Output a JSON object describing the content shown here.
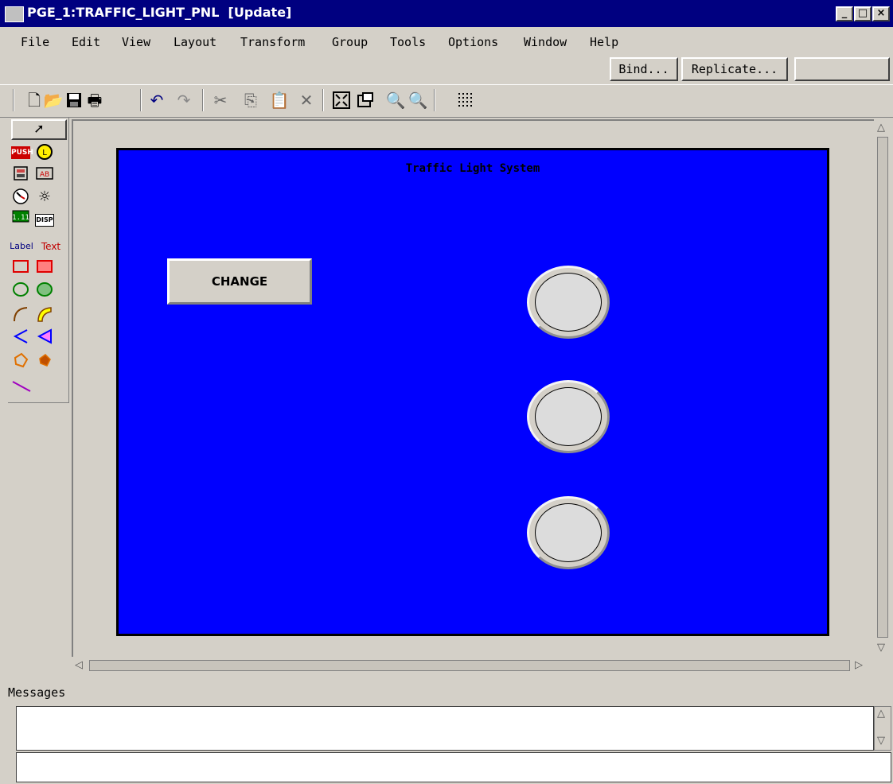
{
  "window": {
    "title": "PGE_1:TRAFFIC_LIGHT_PNL  [Update]",
    "controls": {
      "minimize": "_",
      "maximize": "□",
      "close": "×"
    }
  },
  "menu": {
    "items": [
      "File",
      "Edit",
      "View",
      "Layout",
      "Transform",
      "Group",
      "Tools",
      "Options",
      "Window",
      "Help"
    ]
  },
  "bindbar": {
    "bind_label": "Bind...",
    "replicate_label": "Replicate...",
    "blank_field": ""
  },
  "toolbar": {
    "icons": [
      "new-document-icon",
      "open-folder-icon",
      "save-icon",
      "print-icon",
      "undo-icon",
      "redo-icon",
      "cut-icon",
      "copy-icon",
      "paste-icon",
      "delete-icon",
      "fit-window-icon",
      "zoom-box-icon",
      "zoom-in-icon",
      "zoom-out-icon",
      "grid-icon"
    ]
  },
  "palette": {
    "push_label": "PUSH",
    "disp_label": "DISP",
    "label_tool": "Label",
    "text_tool": "Text"
  },
  "panel": {
    "title": "Traffic Light System",
    "background": "#0000ff",
    "change_button": "CHANGE",
    "lamps": [
      "top",
      "middle",
      "bottom"
    ]
  },
  "messages": {
    "label": "Messages",
    "content": "",
    "command": ""
  }
}
